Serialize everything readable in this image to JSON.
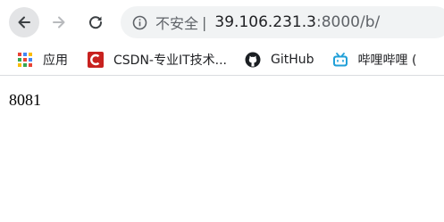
{
  "toolbar": {
    "security_label": "不安全",
    "separator": "|",
    "url_host": "39.106.231.3",
    "url_path": ":8000/b/"
  },
  "bookmarks": [
    {
      "label": "应用",
      "icon": "apps-grid-icon"
    },
    {
      "label": "CSDN-专业IT技术...",
      "icon": "csdn-icon"
    },
    {
      "label": "GitHub",
      "icon": "github-icon"
    },
    {
      "label": "哔哩哔哩 (",
      "icon": "bilibili-icon"
    }
  ],
  "page": {
    "body_text": "8081"
  },
  "colors": {
    "csdn_red": "#c8221f",
    "bilibili_blue": "#21a0d8",
    "omnibox_bg": "#f1f3f4"
  }
}
